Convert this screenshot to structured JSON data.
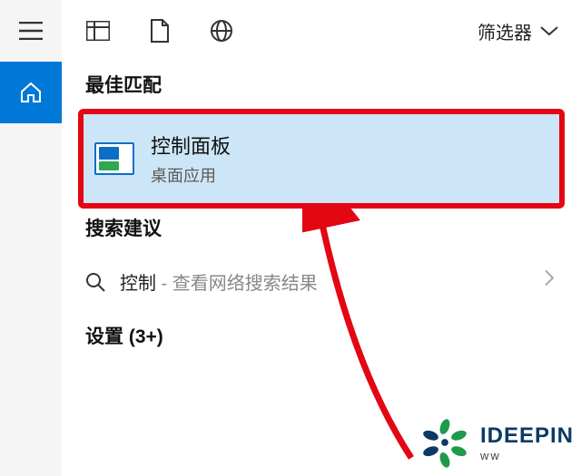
{
  "topbar": {
    "filter_label": "筛选器"
  },
  "sidebar": {
    "items": [
      {
        "name": "menu",
        "active": false
      },
      {
        "name": "home",
        "active": true
      }
    ]
  },
  "sections": {
    "best_match": "最佳匹配",
    "search_suggestions": "搜索建议",
    "settings_label": "设置",
    "settings_count": "(3+)"
  },
  "best_match_result": {
    "title": "控制面板",
    "subtitle": "桌面应用",
    "icon": "control-panel-icon"
  },
  "suggestion": {
    "term": "控制",
    "separator": " - ",
    "hint": "查看网络搜索结果"
  },
  "watermark": {
    "brand": "IDEEPIN",
    "sub": "ww"
  }
}
